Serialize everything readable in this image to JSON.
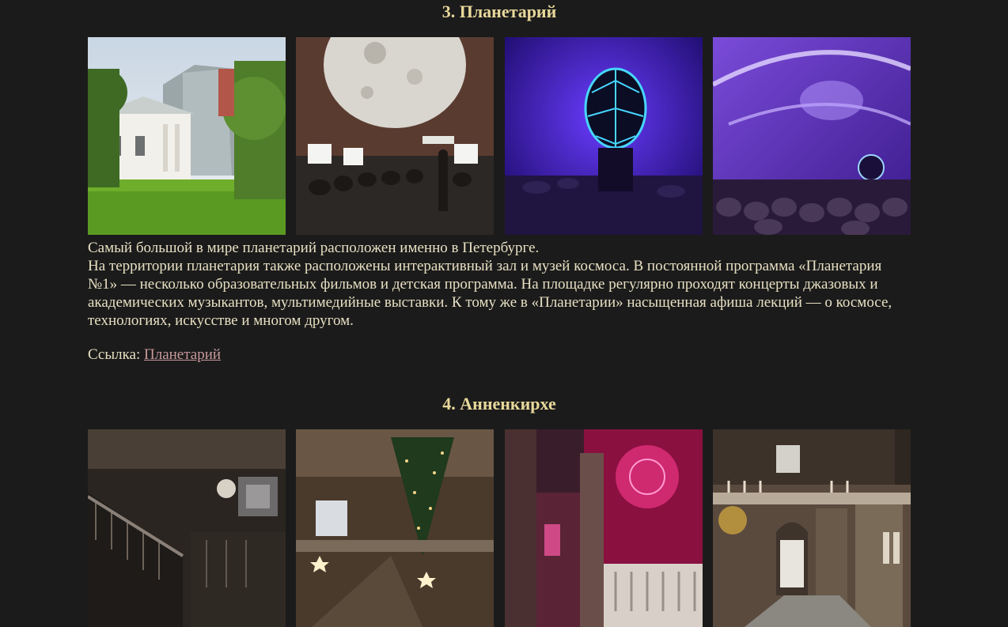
{
  "sections": [
    {
      "title": "3. Планетарий",
      "description_lines": [
        "Самый большой в мире планетарий расположен именно в Петербурге.",
        "На территории планетария также расположены интерактивный зал и музей космоса. В постоянной программа «Планетария №1» — несколько образовательных фильмов и детская программа. На площадке регулярно проходят концерты джазовых и академических музыкантов, мультимедийные выставки. К тому же в «Планетарии» насыщенная афиша лекций — о космосе, технологиях, искусстве и многом другом."
      ],
      "link_prefix": "Ссылка:",
      "link_text": "Планетарий"
    },
    {
      "title": "4. Анненкирхе"
    }
  ],
  "colors": {
    "background": "#1b1b1b",
    "heading": "#e8d89a",
    "text": "#e8e0c3",
    "link": "#c9999b"
  }
}
